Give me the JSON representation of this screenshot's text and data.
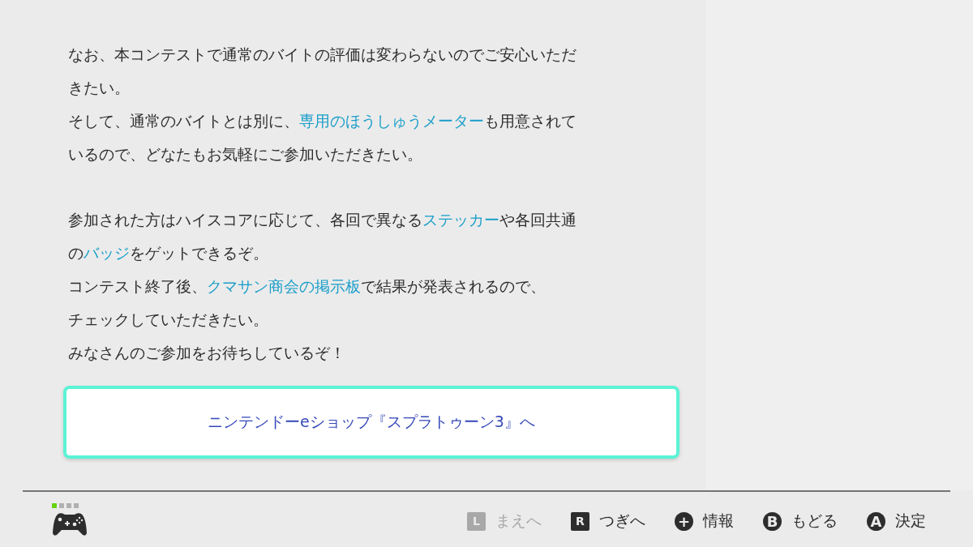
{
  "article": {
    "paragraphs": [
      {
        "lines": [
          [
            {
              "text": "なお、本コンテストで通常のバイトの評価は変わらないのでご安心いただ",
              "kind": "text"
            }
          ],
          [
            {
              "text": "きたい。",
              "kind": "text"
            }
          ],
          [
            {
              "text": "そして、通常のバイトとは別に、",
              "kind": "text"
            },
            {
              "text": "専用のほうしゅうメーター",
              "kind": "link"
            },
            {
              "text": "も用意されて",
              "kind": "text"
            }
          ],
          [
            {
              "text": "いるので、どなたもお気軽にご参加いただきたい。",
              "kind": "text"
            }
          ]
        ]
      },
      {
        "lines": [
          [
            {
              "text": "参加された方はハイスコアに応じて、各回で異なる",
              "kind": "text"
            },
            {
              "text": "ステッカー",
              "kind": "link"
            },
            {
              "text": "や各回共通",
              "kind": "text"
            }
          ],
          [
            {
              "text": "の",
              "kind": "text"
            },
            {
              "text": "バッジ",
              "kind": "link"
            },
            {
              "text": "をゲットできるぞ。",
              "kind": "text"
            }
          ],
          [
            {
              "text": "コンテスト終了後、",
              "kind": "text"
            },
            {
              "text": "クマサン商会の掲示板",
              "kind": "link"
            },
            {
              "text": "で結果が発表されるので、",
              "kind": "text"
            }
          ],
          [
            {
              "text": "チェックしていただきたい。",
              "kind": "text"
            }
          ],
          [
            {
              "text": "みなさんのご参加をお待ちしているぞ！",
              "kind": "text"
            }
          ]
        ]
      }
    ],
    "shop_button": {
      "label": "ニンテンドーeショップ『スプラトゥーン3』へ",
      "selected": true
    }
  },
  "footer": {
    "player_lights": [
      {
        "on": true
      },
      {
        "on": false
      },
      {
        "on": false
      },
      {
        "on": false
      }
    ],
    "hints": [
      {
        "key": "L",
        "kind": "shoulder",
        "label": "まえへ",
        "disabled": true
      },
      {
        "key": "R",
        "kind": "shoulder",
        "label": "つぎへ",
        "disabled": false
      },
      {
        "key": "+",
        "kind": "face",
        "label": "情報",
        "disabled": false
      },
      {
        "key": "B",
        "kind": "face",
        "label": "もどる",
        "disabled": false
      },
      {
        "key": "A",
        "kind": "face",
        "label": "決定",
        "disabled": false
      }
    ]
  }
}
